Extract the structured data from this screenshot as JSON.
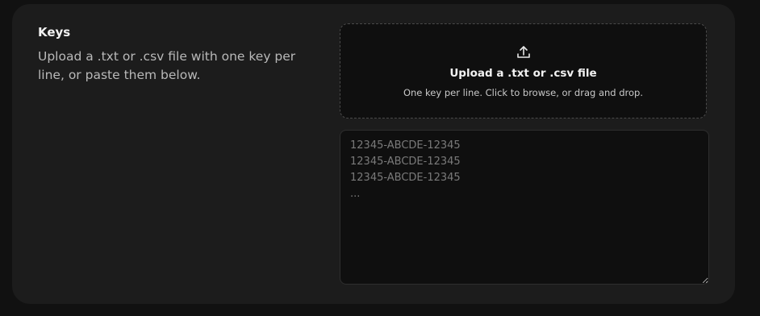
{
  "section": {
    "title": "Keys",
    "description": "Upload a .txt or .csv file with one key per line, or paste them below."
  },
  "upload": {
    "icon": "upload-icon",
    "title": "Upload a .txt or .csv file",
    "subtitle": "One key per line. Click to browse, or drag and drop."
  },
  "keys_input": {
    "value": "",
    "placeholder": "12345-ABCDE-12345\n12345-ABCDE-12345\n12345-ABCDE-12345\n..."
  },
  "colors": {
    "page_bg": "#111111",
    "card_bg": "#1c1c1c",
    "input_bg": "#0f0f0f",
    "dashed_border": "#4a4a4a"
  }
}
